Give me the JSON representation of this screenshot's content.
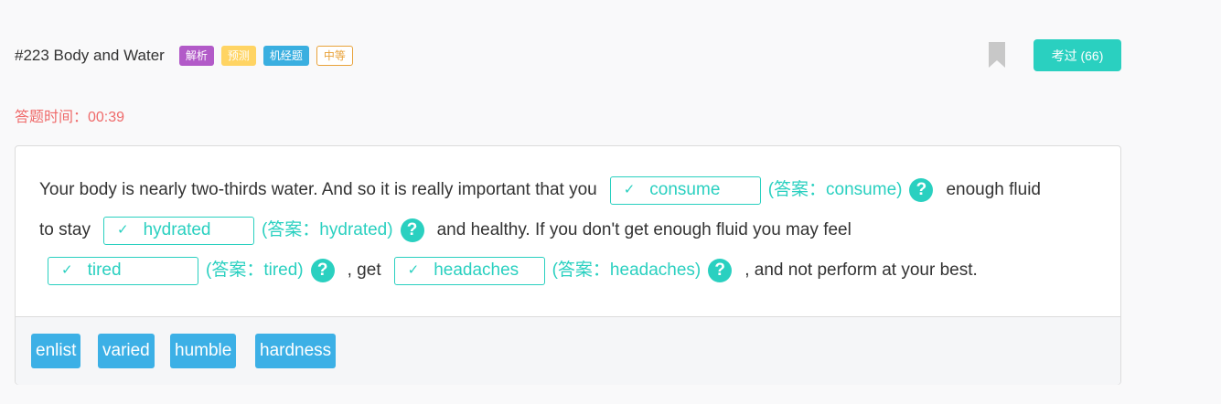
{
  "header": {
    "title": "#223 Body and Water",
    "tags": [
      "解析",
      "预测",
      "机经题",
      "中等"
    ],
    "exam_button": "考过 (66)"
  },
  "timer": "答题时间：00:39",
  "passage": {
    "seg1": "Your body is nearly two-thirds water. And so it is really important that you",
    "blank1": {
      "check": "✓",
      "value": "consume",
      "answer": "(答案：consume)"
    },
    "seg2": "enough fluid",
    "seg3": "to stay",
    "blank2": {
      "check": "✓",
      "value": "hydrated",
      "answer": "(答案：hydrated)"
    },
    "seg4": "and healthy. If you don't get enough fluid you may feel",
    "blank3": {
      "check": "✓",
      "value": "tired",
      "answer": "(答案：tired)"
    },
    "seg5": ", get",
    "blank4": {
      "check": "✓",
      "value": "headaches",
      "answer": "(答案：headaches)"
    },
    "seg6": ", and not perform at your best.",
    "help_icon": "?"
  },
  "options": [
    "enlist",
    "varied",
    "humble",
    "hardness"
  ],
  "colors": {
    "accent": "#2ad0c0",
    "timer": "#ef6a6a",
    "option": "#3cb0e6"
  }
}
